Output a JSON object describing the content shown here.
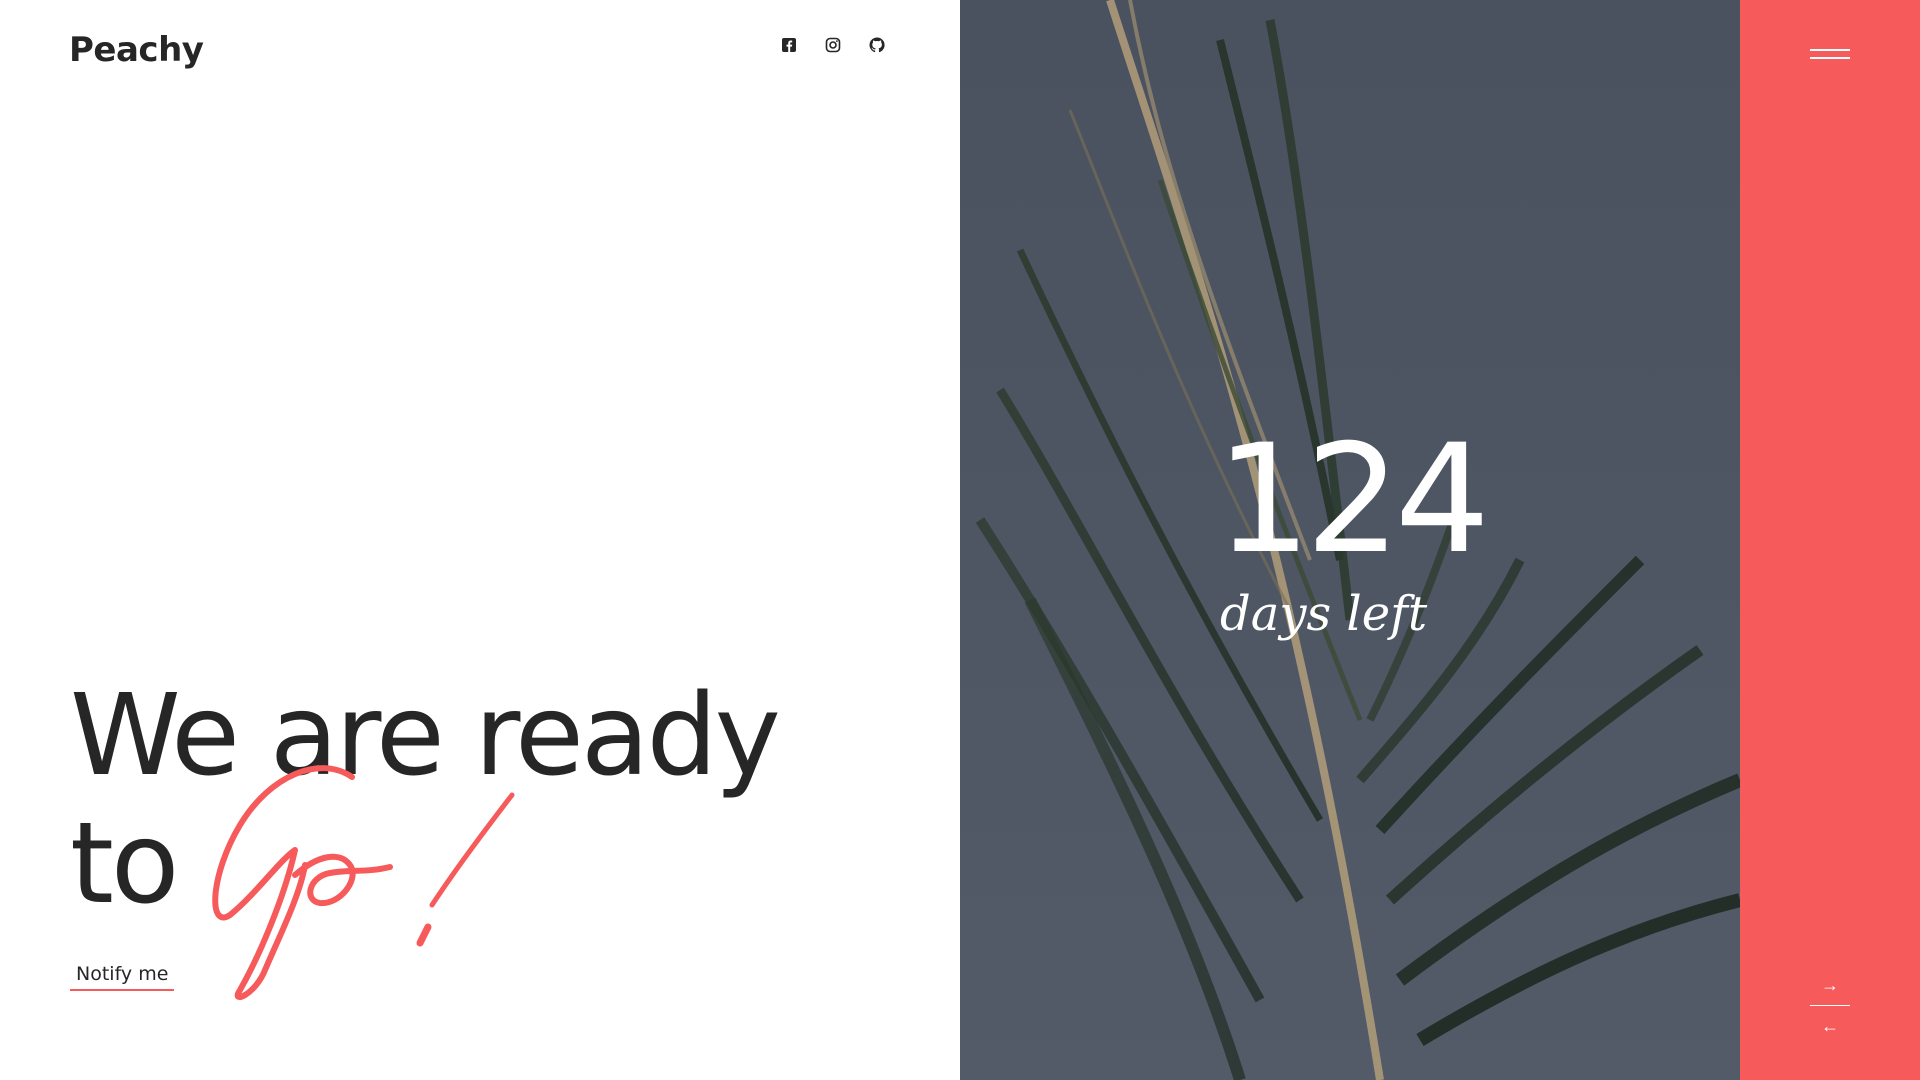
{
  "brand": {
    "logo_text": "Peachy"
  },
  "header": {
    "social_icons": [
      "facebook-icon",
      "instagram-icon",
      "github-icon"
    ]
  },
  "hero": {
    "line1": "We are ready",
    "line2_prefix": "to",
    "script_word": "Go!",
    "notify_label": "Notify me"
  },
  "countdown": {
    "value": "124",
    "caption": "days left"
  },
  "accent_panel": {
    "menu_icon": "hamburger-menu-icon",
    "next_icon": "arrow-right-icon",
    "prev_icon": "arrow-left-icon",
    "next_glyph": "→",
    "prev_glyph": "←"
  },
  "colors": {
    "accent": "#f65a5a",
    "text_dark": "#262626",
    "photo_bg": "#4d5563",
    "white": "#ffffff"
  }
}
